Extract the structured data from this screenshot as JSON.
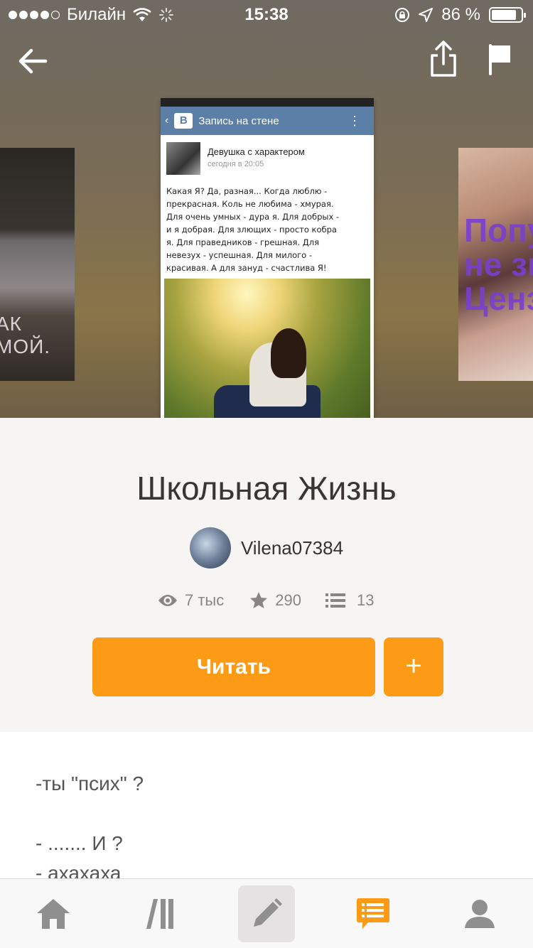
{
  "status_bar": {
    "carrier": "Билайн",
    "time": "15:38",
    "battery_percent": "86 %",
    "battery_level": 0.86,
    "signal_bars": 4
  },
  "nav": {
    "back_icon": "arrow-left-icon",
    "share_icon": "share-icon",
    "flag_icon": "flag-icon"
  },
  "cover": {
    "vk_logo": "B",
    "vk_header": "Запись на стене",
    "post_author": "Девушка с характером",
    "post_date": "сегодня в 20:05",
    "post_lines": [
      "Какая Я? Да, разная... Когда люблю -",
      "прекрасная. Коль не любима - хмурая.",
      "Для очень умных - дура я. Для добрых -",
      "и я добрая. Для злющих - просто кобра",
      "я. Для праведников - грешная. Для",
      "невезух - успешная. Для милого -",
      "красивая. А для зануд - счастлива Я!"
    ]
  },
  "side_covers": {
    "left_text": "АК МОЙ.",
    "right_text": "Попул\nне зна\nЦенз"
  },
  "book": {
    "title": "Школьная Жизнь",
    "author": "Vilena07384"
  },
  "stats": {
    "views": "7 тыс",
    "votes": "290",
    "parts": "13"
  },
  "actions": {
    "read_label": "Читать",
    "add_label": "+"
  },
  "preview": {
    "lines": [
      "-ты \"псих\" ?",
      "",
      "- ....... И ?",
      "- ахахаха"
    ]
  },
  "tabbar": {
    "items": [
      "home-icon",
      "library-icon",
      "write-icon",
      "messages-icon",
      "profile-icon"
    ],
    "active_index": 3,
    "accent": "#fd9a16"
  },
  "colors": {
    "accent": "#fd9a16",
    "vk_blue": "#5b7fa6"
  }
}
